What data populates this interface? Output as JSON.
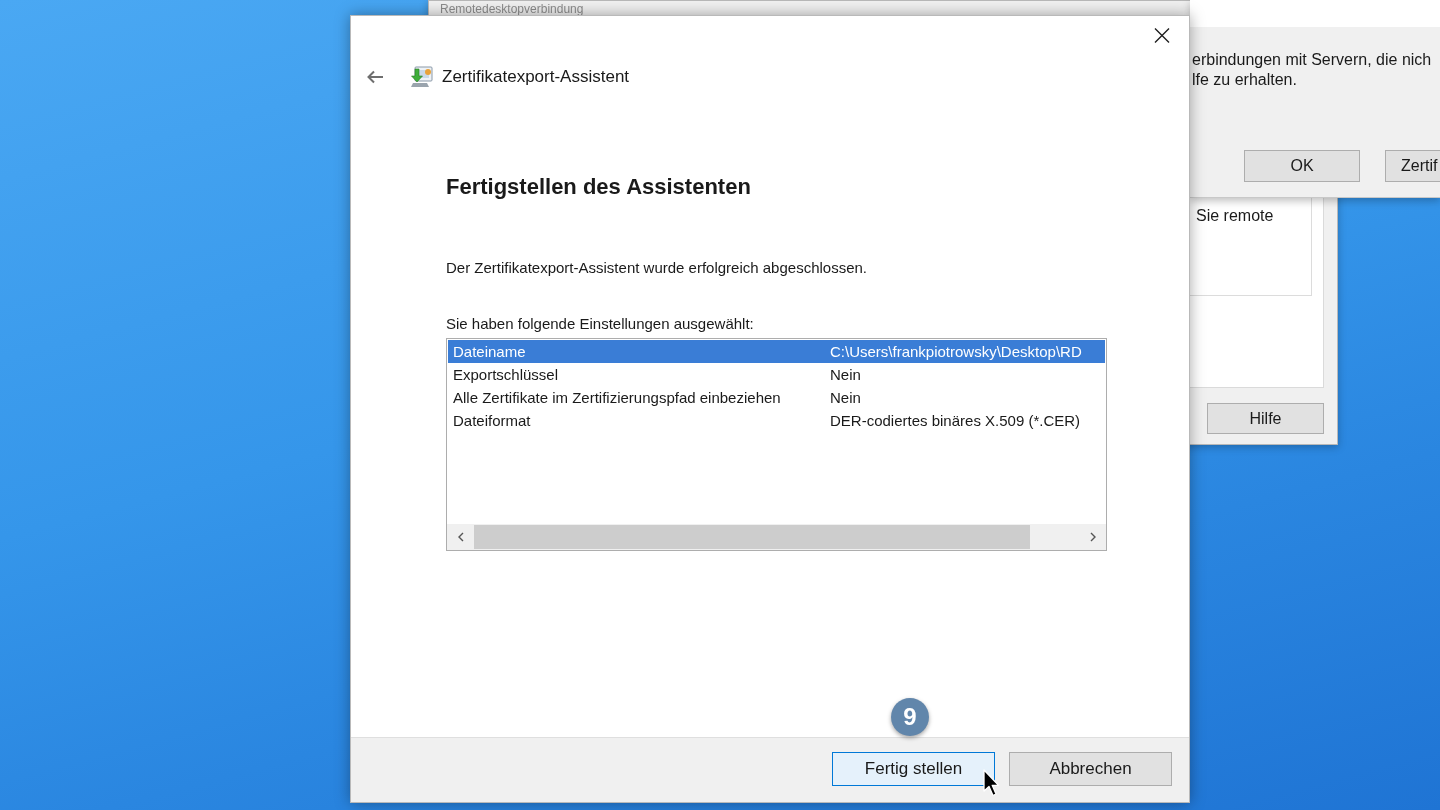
{
  "background_window": {
    "title": "Remotedesktopverbindung",
    "text": "Sie remote",
    "buttons": [
      "Hilfe"
    ]
  },
  "message_box": {
    "text_lines": [
      "erbindungen mit Servern, die nich",
      "lfe zu erhalten."
    ],
    "buttons": [
      "OK",
      "Zertif"
    ]
  },
  "dialog": {
    "title": "Zertifikatexport-Assistent",
    "heading": "Fertigstellen des Assistenten",
    "message": "Der Zertifikatexport-Assistent wurde erfolgreich abgeschlossen.",
    "settings_label": "Sie haben folgende Einstellungen ausgewählt:",
    "settings": [
      {
        "name": "Dateiname",
        "value": "C:\\Users\\frankpiotrowsky\\Desktop\\RD",
        "selected": true
      },
      {
        "name": "Exportschlüssel",
        "value": "Nein",
        "selected": false
      },
      {
        "name": "Alle Zertifikate im Zertifizierungspfad einbeziehen",
        "value": "Nein",
        "selected": false
      },
      {
        "name": "Dateiformat",
        "value": "DER-codiertes binäres X.509 (*.CER)",
        "selected": false
      }
    ],
    "buttons": [
      {
        "label": "Fertig stellen",
        "focused": true
      },
      {
        "label": "Abbrechen",
        "focused": false
      }
    ]
  },
  "step_badge": "9"
}
